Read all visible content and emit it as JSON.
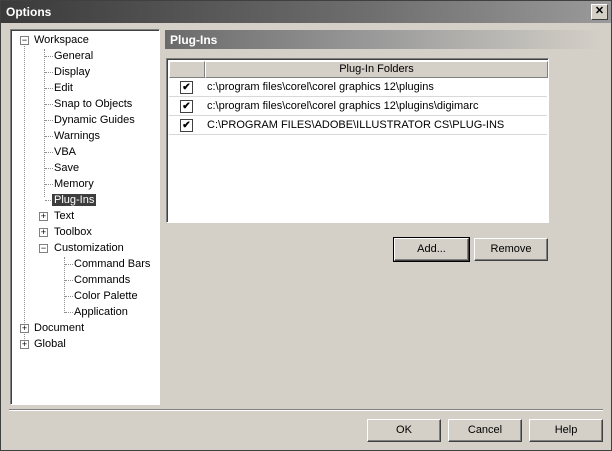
{
  "window": {
    "title": "Options",
    "close_glyph": "✕"
  },
  "tree": {
    "items": [
      {
        "label": "Workspace",
        "expander": "−"
      },
      {
        "label": "General"
      },
      {
        "label": "Display"
      },
      {
        "label": "Edit"
      },
      {
        "label": "Snap to Objects"
      },
      {
        "label": "Dynamic Guides"
      },
      {
        "label": "Warnings"
      },
      {
        "label": "VBA"
      },
      {
        "label": "Save"
      },
      {
        "label": "Memory"
      },
      {
        "label": "Plug-Ins",
        "selected": true
      },
      {
        "label": "Text",
        "expander": "+"
      },
      {
        "label": "Toolbox",
        "expander": "+"
      },
      {
        "label": "Customization",
        "expander": "−"
      },
      {
        "label": "Command Bars"
      },
      {
        "label": "Commands"
      },
      {
        "label": "Color Palette"
      },
      {
        "label": "Application"
      },
      {
        "label": "Document",
        "expander": "+"
      },
      {
        "label": "Global",
        "expander": "+"
      }
    ]
  },
  "panel": {
    "title": "Plug-Ins",
    "column_header": "Plug-In Folders",
    "rows": [
      {
        "checked": true,
        "path": "c:\\program files\\corel\\corel graphics 12\\plugins"
      },
      {
        "checked": true,
        "path": "c:\\program files\\corel\\corel graphics 12\\plugins\\digimarc"
      },
      {
        "checked": true,
        "path": "C:\\PROGRAM FILES\\ADOBE\\ILLUSTRATOR CS\\PLUG-INS"
      }
    ],
    "check_glyph": "✔",
    "add_label": "Add...",
    "remove_label": "Remove"
  },
  "footer": {
    "ok_label": "OK",
    "cancel_label": "Cancel",
    "help_label": "Help"
  }
}
